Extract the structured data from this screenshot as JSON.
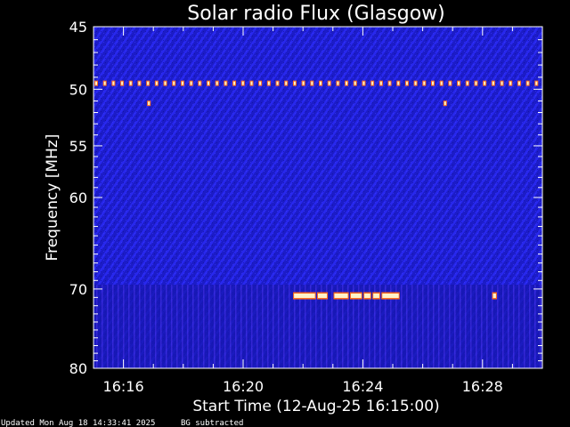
{
  "chart_data": {
    "type": "heatmap",
    "title": "Solar radio Flux (Glasgow)",
    "xlabel": "Start Time (12-Aug-25 16:15:00)",
    "ylabel": "Frequency [MHz]",
    "x_unit": "minutes after 16:15:00",
    "xlim": [
      0,
      15
    ],
    "x_ticks": [
      {
        "value": 1,
        "label": "16:16"
      },
      {
        "value": 5,
        "label": "16:20"
      },
      {
        "value": 9,
        "label": "16:24"
      },
      {
        "value": 13,
        "label": "16:28"
      }
    ],
    "y_scale": "log",
    "ylim": [
      45,
      80
    ],
    "y_ticks": [
      45,
      50,
      55,
      60,
      70,
      80
    ],
    "colors": {
      "background": "#000000",
      "spectrogram_base": "#1c1cc8",
      "spectrogram_texture": "#2626ee",
      "low_band": "#1414a8",
      "interference_dash": "#fff2c8",
      "interference_glow": "#ff6a1a"
    },
    "features": [
      {
        "name": "periodic interference line",
        "freq_mhz": 49.5,
        "x_start": 0,
        "x_end": 15,
        "dash_count": 52
      },
      {
        "name": "spot",
        "freq_mhz": 51.2,
        "x": 1.85
      },
      {
        "name": "spot",
        "freq_mhz": 51.2,
        "x": 11.75
      },
      {
        "name": "interference band",
        "freq_mhz": 70.8,
        "segments": [
          [
            6.7,
            7.4
          ],
          [
            7.5,
            7.8
          ],
          [
            8.05,
            8.5
          ],
          [
            8.6,
            8.95
          ],
          [
            9.05,
            9.25
          ],
          [
            9.35,
            9.55
          ],
          [
            9.65,
            10.2
          ],
          [
            13.35,
            13.45
          ]
        ]
      }
    ]
  },
  "footer": {
    "updated": "Updated Mon Aug 18 14:33:41 2025",
    "note": "BG subtracted"
  }
}
